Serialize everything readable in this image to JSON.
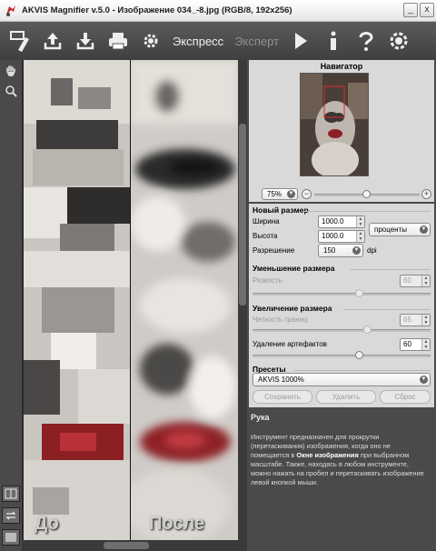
{
  "window": {
    "title": "AKVIS Magnifier v.5.0 - Изображение 034_-8.jpg (RGB/8, 192x256)",
    "minimize": "_",
    "close": "x"
  },
  "toolbar": {
    "mode_express": "Экспресс",
    "mode_expert": "Эксперт",
    "icons": [
      "brush-icon",
      "upload-icon",
      "download-icon",
      "print-icon",
      "settings-gear-icon",
      "run-icon",
      "info-icon",
      "help-icon",
      "preferences-icon"
    ]
  },
  "preview": {
    "before_label": "До",
    "after_label": "После"
  },
  "navigator": {
    "title": "Навигатор",
    "zoom": "75%",
    "zoom_level": 0.5
  },
  "new_size": {
    "title": "Новый размер",
    "width_label": "Ширина",
    "width_value": "1000.0",
    "height_label": "Высота",
    "height_value": "1000.0",
    "unit": "проценты",
    "resolution_label": "Разрешение",
    "resolution_value": "150",
    "resolution_unit": "dpi"
  },
  "reduce": {
    "title": "Уменьшение размера",
    "sharpness_label": "Резкость",
    "sharpness_value": "60",
    "sharpness_level": 0.6
  },
  "enlarge": {
    "title": "Увеличение размера",
    "edge_label": "Четкость границ",
    "edge_value": "65",
    "edge_level": 0.65,
    "artifact_label": "Удаление артефактов",
    "artifact_value": "60",
    "artifact_level": 0.6
  },
  "presets": {
    "title": "Пресеты",
    "selected": "AKVIS 1000%",
    "save": "Сохранить",
    "delete": "Удалить",
    "reset": "Сброс"
  },
  "help": {
    "title": "Рука",
    "text_part1": "Инструмент предназначен для прокрутки (перетаскивания) изображения, когда оно не помещается в",
    "text_bold": "Окне изображения",
    "text_part2": "при выбранном масштабе. Также, находясь в любом инструменте, можно нажать на пробел и перетаскивать изображение левой кнопкой мыши."
  },
  "colors": {
    "toolbar_bg": "#4b4b4b",
    "panel_bg": "#d9d9d9",
    "accent_inactive": "#8e8e8e"
  }
}
